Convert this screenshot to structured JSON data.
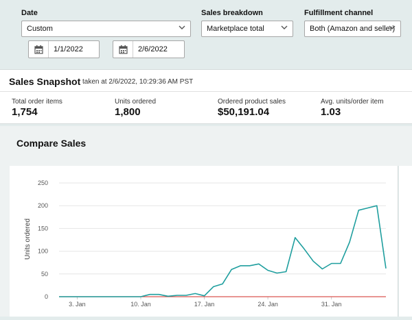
{
  "filters": {
    "date": {
      "label": "Date",
      "selected": "Custom",
      "start": "1/1/2022",
      "end": "2/6/2022"
    },
    "breakdown": {
      "label": "Sales breakdown",
      "selected": "Marketplace total"
    },
    "fulfillment": {
      "label": "Fulfillment channel",
      "selected": "Both (Amazon and seller)"
    }
  },
  "snapshot": {
    "title": "Sales Snapshot",
    "subtitle": "taken at 2/6/2022, 10:29:36 AM PST",
    "metrics": [
      {
        "label": "Total order items",
        "value": "1,754"
      },
      {
        "label": "Units ordered",
        "value": "1,800"
      },
      {
        "label": "Ordered product sales",
        "value": "$50,191.04"
      },
      {
        "label": "Avg. units/order item",
        "value": "1.03"
      }
    ]
  },
  "compare": {
    "title": "Compare Sales"
  },
  "colors": {
    "units_line": "#1e9e9e",
    "baseline_line": "#d9534f",
    "grid": "#e6e6e6",
    "background": "#e3ecec"
  },
  "chart_data": {
    "type": "line",
    "ylabel": "Units ordered",
    "ylim": [
      0,
      250
    ],
    "yticks": [
      "0",
      "50",
      "100",
      "150",
      "200",
      "250"
    ],
    "xtick_labels": [
      "3. Jan",
      "10. Jan",
      "17. Jan",
      "24. Jan",
      "31. Jan"
    ],
    "x": [
      "1/1",
      "1/2",
      "1/3",
      "1/4",
      "1/5",
      "1/6",
      "1/7",
      "1/8",
      "1/9",
      "1/10",
      "1/11",
      "1/12",
      "1/13",
      "1/14",
      "1/15",
      "1/16",
      "1/17",
      "1/18",
      "1/19",
      "1/20",
      "1/21",
      "1/22",
      "1/23",
      "1/24",
      "1/25",
      "1/26",
      "1/27",
      "1/28",
      "1/29",
      "1/30",
      "1/31",
      "2/1",
      "2/2",
      "2/3",
      "2/4",
      "2/5",
      "2/6"
    ],
    "grid": true,
    "series": [
      {
        "name": "",
        "color": "#1e9e9e",
        "values": [
          0,
          0,
          0,
          0,
          0,
          0,
          0,
          0,
          0,
          0,
          5,
          5,
          1,
          3,
          3,
          7,
          2,
          22,
          28,
          60,
          68,
          68,
          72,
          58,
          52,
          55,
          130,
          105,
          78,
          61,
          73,
          73,
          120,
          190,
          195,
          200,
          62
        ]
      },
      {
        "name": "",
        "color": "#d9534f",
        "values": [
          0,
          0,
          0,
          0,
          0,
          0,
          0,
          0,
          0,
          0,
          0,
          0,
          0,
          0,
          0,
          0,
          0,
          0,
          0,
          0,
          0,
          0,
          0,
          0,
          0,
          0,
          0,
          0,
          0,
          0,
          0,
          0,
          0,
          0,
          0,
          0,
          0
        ]
      }
    ]
  }
}
